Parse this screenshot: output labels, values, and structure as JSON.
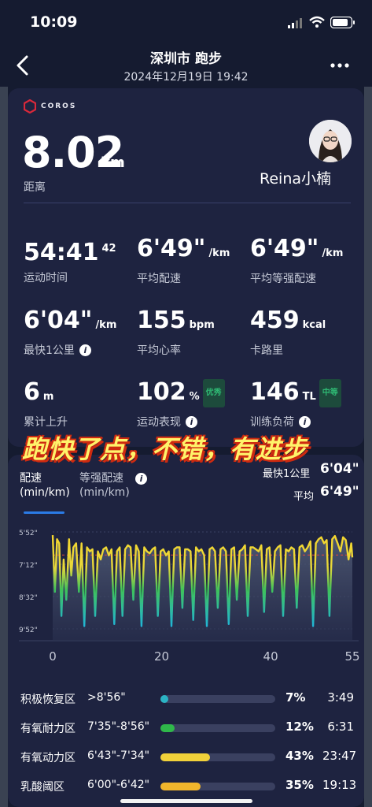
{
  "status": {
    "time": "10:09"
  },
  "header": {
    "title": "深圳市 跑步",
    "subtitle": "2024年12月19日 19:42"
  },
  "summary": {
    "brand": "COROS",
    "distance_value": "8.02",
    "distance_unit": "km",
    "distance_label": "距离",
    "username": "Reina小楠"
  },
  "stats": [
    {
      "value": "54:41",
      "sup": "42",
      "unit": "",
      "label": "运动时间"
    },
    {
      "value": "6'49\"",
      "unit": "/km",
      "label": "平均配速"
    },
    {
      "value": "6'49\"",
      "unit": "/km",
      "label": "平均等强配速"
    },
    {
      "value": "6'04\"",
      "unit": "/km",
      "label": "最快1公里"
    },
    {
      "value": "155",
      "unit": "bpm",
      "label": "平均心率"
    },
    {
      "value": "459",
      "unit": "kcal",
      "label": "卡路里"
    },
    {
      "value": "6",
      "unit": "m",
      "label": "累计上升"
    },
    {
      "value": "102",
      "unit": "%",
      "badge": "优秀",
      "label": "运动表现"
    },
    {
      "value": "146",
      "unit": "TL",
      "badge": "中等",
      "label": "训练负荷"
    }
  ],
  "overlay_text": "跑快了点，不错，有进步",
  "chart_panel": {
    "tab_pace": "配速",
    "tab_pace_unit": "(min/km)",
    "tab_eq": "等强配速",
    "tab_eq_unit": "(min/km)",
    "fastest_label": "最快1公里",
    "fastest_value": "6'04\"",
    "avg_label": "平均",
    "avg_value": "6'49\""
  },
  "chart_data": {
    "type": "line",
    "xlabel": "",
    "ylabel": "",
    "x_ticks": [
      0,
      20,
      40,
      55
    ],
    "xlim": [
      0,
      55
    ],
    "y_ticks": [
      "5'52\"",
      "7'12\"",
      "8'32\"",
      "9'52\""
    ],
    "ylim_seconds": [
      352,
      592
    ],
    "y_inverted": true,
    "average_line_seconds": 409,
    "series": [
      {
        "x": [
          0,
          0.4,
          0.8,
          1.2,
          1.6,
          2,
          2.5,
          3,
          3.4,
          3.8,
          4.3,
          4.8,
          5.3,
          5.8,
          6.3,
          6.8,
          7.3,
          7.8,
          8.3,
          8.8,
          9.3,
          9.8,
          10.3,
          10.8,
          11.3,
          11.8,
          12.3,
          12.8,
          13.3,
          13.8,
          14.3,
          14.8,
          15.3,
          15.8,
          16.3,
          16.8,
          17.3,
          17.8,
          18.3,
          18.8,
          19.3,
          19.8,
          20.3,
          20.8,
          21.3,
          21.8,
          22.3,
          22.8,
          23.3,
          23.8,
          24.3,
          24.8,
          25.3,
          25.8,
          26.3,
          26.8,
          27.3,
          27.8,
          28.3,
          28.8,
          29.3,
          29.8,
          30.3,
          30.8,
          31.3,
          31.8,
          32.3,
          32.8,
          33.3,
          33.8,
          34.3,
          34.8,
          35.3,
          35.8,
          36.3,
          36.8,
          37.3,
          37.8,
          38.3,
          38.8,
          39.3,
          39.8,
          40.3,
          40.8,
          41.3,
          41.8,
          42.3,
          42.8,
          43.3,
          43.8,
          44.3,
          44.8,
          45.3,
          45.8,
          46.3,
          46.8,
          47.3,
          47.8,
          48.3,
          48.8,
          49.3,
          49.8,
          50.3,
          50.8,
          51.3,
          51.8,
          52.3,
          52.8,
          53.3,
          53.8,
          54.3,
          54.8,
          55
        ],
        "y": [
          360,
          500,
          370,
          380,
          560,
          420,
          520,
          370,
          460,
          390,
          380,
          500,
          380,
          585,
          390,
          400,
          395,
          560,
          400,
          420,
          395,
          390,
          410,
          395,
          580,
          400,
          390,
          560,
          395,
          385,
          390,
          520,
          385,
          400,
          585,
          390,
          400,
          405,
          395,
          390,
          560,
          400,
          395,
          410,
          400,
          585,
          395,
          390,
          390,
          540,
          395,
          395,
          400,
          570,
          390,
          400,
          395,
          410,
          585,
          395,
          390,
          400,
          540,
          395,
          390,
          400,
          580,
          395,
          390,
          520,
          400,
          395,
          385,
          560,
          390,
          390,
          395,
          400,
          385,
          550,
          395,
          390,
          500,
          400,
          390,
          385,
          560,
          395,
          400,
          390,
          395,
          540,
          390,
          385,
          400,
          390,
          375,
          585,
          380,
          370,
          365,
          380,
          372,
          560,
          370,
          362,
          380,
          400,
          365,
          372,
          420,
          380,
          415
        ]
      }
    ]
  },
  "zones": [
    {
      "name": "积极恢复区",
      "range": ">8'56\"",
      "pct_value": 7,
      "pct": "7%",
      "time": "3:49",
      "color": "#2bb3c4"
    },
    {
      "name": "有氧耐力区",
      "range": "7'35\"-8'56\"",
      "pct_value": 12,
      "pct": "12%",
      "time": "6:31",
      "color": "#2fb84a"
    },
    {
      "name": "有氧动力区",
      "range": "6'43\"-7'34\"",
      "pct_value": 43,
      "pct": "43%",
      "time": "23:47",
      "color": "#f1d13a"
    },
    {
      "name": "乳酸阈区",
      "range": "6'00\"-6'42\"",
      "pct_value": 35,
      "pct": "35%",
      "time": "19:13",
      "color": "#f0b52c"
    }
  ]
}
